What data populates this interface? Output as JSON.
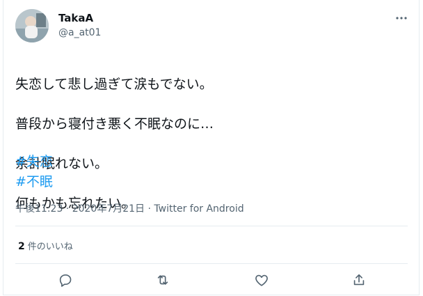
{
  "user": {
    "display_name": "TakaA",
    "handle": "@a_at01"
  },
  "tweet": {
    "lines": [
      "失恋して悲し過ぎて涙もでない。",
      "普段から寝付き悪く不眠なのに…",
      "余計眠れない。",
      "何もかも忘れたい。"
    ],
    "hashtags": [
      "#失恋",
      "#不眠"
    ]
  },
  "meta": {
    "timestamp": "午後11:23 · 2020年7月21日 · Twitter for Android"
  },
  "stats": {
    "likes_count": "2",
    "likes_label": "件のいいね"
  },
  "icons": {
    "more": "more-horizontal-icon",
    "reply": "reply-icon",
    "retweet": "retweet-icon",
    "like": "heart-icon",
    "share": "share-icon"
  },
  "colors": {
    "hashtag": "#1d9bf0",
    "secondary_text": "#536471",
    "divider": "#e6ecf0"
  }
}
